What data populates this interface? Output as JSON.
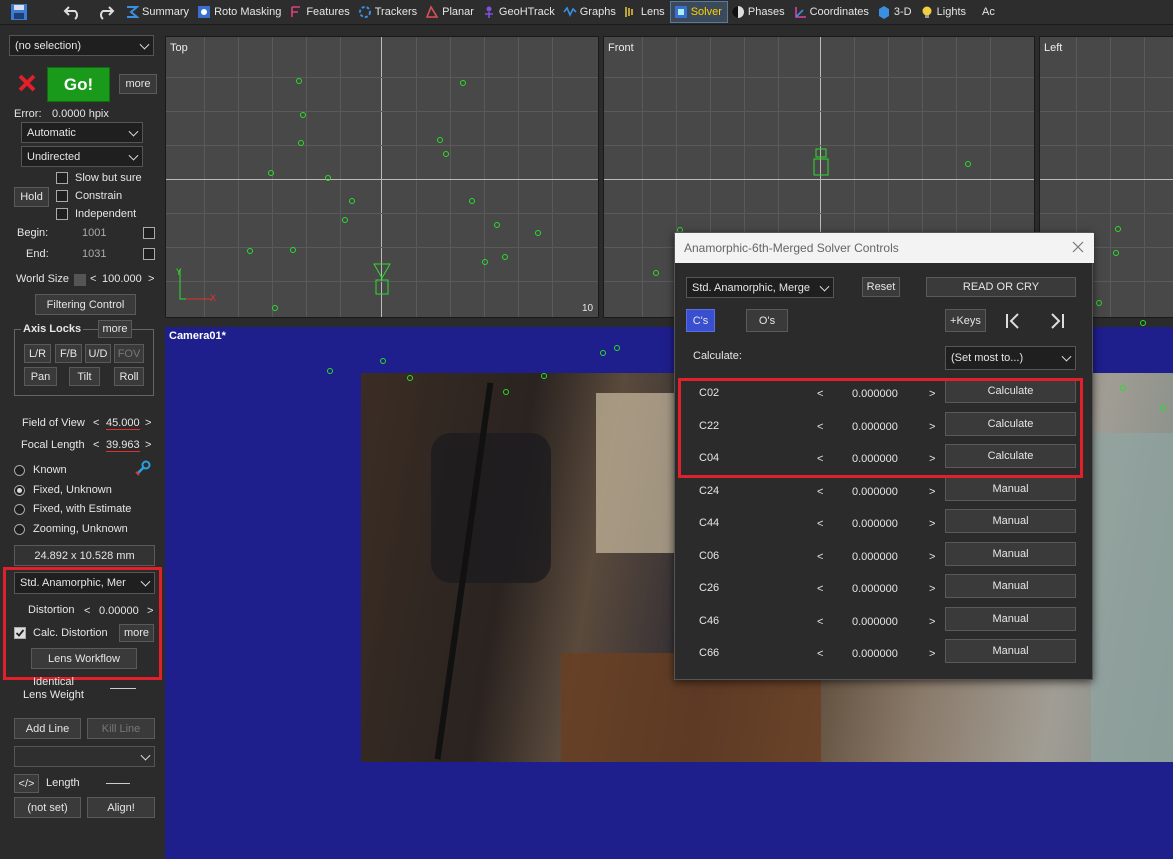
{
  "toolbar": {
    "tabs": [
      {
        "label": "Summary",
        "icon": "summary-icon"
      },
      {
        "label": "Roto Masking",
        "icon": "roto-icon"
      },
      {
        "label": "Features",
        "icon": "features-icon"
      },
      {
        "label": "Trackers",
        "icon": "trackers-icon"
      },
      {
        "label": "Planar",
        "icon": "planar-icon"
      },
      {
        "label": "GeoHTrack",
        "icon": "geohtrack-icon"
      },
      {
        "label": "Graphs",
        "icon": "graphs-icon"
      },
      {
        "label": "Lens",
        "icon": "lens-icon"
      },
      {
        "label": "Solver",
        "icon": "solver-icon",
        "active": true
      },
      {
        "label": "Phases",
        "icon": "phases-icon"
      },
      {
        "label": "Coordinates",
        "icon": "coordinates-icon"
      },
      {
        "label": "3-D",
        "icon": "3d-icon"
      },
      {
        "label": "Lights",
        "icon": "lights-icon"
      }
    ],
    "overflow": "Ac"
  },
  "left": {
    "selection": "(no selection)",
    "go_label": "Go!",
    "more_label": "more",
    "error_label": "Error:",
    "error_value": "0.0000 hpix",
    "mode": "Automatic",
    "direction": "Undirected",
    "slow_but_sure": "Slow but sure",
    "constrain": "Constrain",
    "independent": "Independent",
    "hold_label": "Hold",
    "begin_label": "Begin:",
    "begin_value": "1001",
    "end_label": "End:",
    "end_value": "1031",
    "world_size_label": "World Size",
    "world_size_value": "100.000",
    "filtering_control": "Filtering Control",
    "axis_locks": "Axis Locks",
    "axis_more": "more",
    "axis_buttons": [
      "L/R",
      "F/B",
      "U/D",
      "FOV",
      "Pan",
      "Tilt",
      "Roll"
    ],
    "fov_label": "Field of View",
    "fov_value": "45.000",
    "focal_label": "Focal Length",
    "focal_value": "39.963",
    "lens_modes": [
      "Known",
      "Fixed, Unknown",
      "Fixed, with Estimate",
      "Zooming, Unknown"
    ],
    "sensor_size": "24.892 x 10.528 mm",
    "lens_model": "Std. Anamorphic, Mer",
    "distortion_label": "Distortion",
    "distortion_value": "0.00000",
    "calc_distortion": "Calc. Distortion",
    "calc_more": "more",
    "lens_workflow": "Lens Workflow",
    "identical_lens_weight": "Identical Lens Weight",
    "add_line": "Add Line",
    "kill_line": "Kill Line",
    "length_label": "Length",
    "not_set": "(not set)",
    "align": "Align!",
    "code_icon_label": "</>"
  },
  "viewports": {
    "top": {
      "label": "Top",
      "corner": "10"
    },
    "front": {
      "label": "Front"
    },
    "left": {
      "label": "Left"
    },
    "camera": {
      "label": "Camera01*"
    }
  },
  "dialog": {
    "title": "Anamorphic-6th-Merged Solver Controls",
    "model_select": "Std. Anamorphic, Merge",
    "reset": "Reset",
    "read_or_cry": "READ OR CRY",
    "cs": "C's",
    "os": "O's",
    "plus_keys": "+Keys",
    "calculate_label": "Calculate:",
    "set_most": "(Set most to...)",
    "rows": [
      {
        "name": "C02",
        "value": "0.000000",
        "action": "Calculate"
      },
      {
        "name": "C22",
        "value": "0.000000",
        "action": "Calculate"
      },
      {
        "name": "C04",
        "value": "0.000000",
        "action": "Calculate"
      },
      {
        "name": "C24",
        "value": "0.000000",
        "action": "Manual"
      },
      {
        "name": "C44",
        "value": "0.000000",
        "action": "Manual"
      },
      {
        "name": "C06",
        "value": "0.000000",
        "action": "Manual"
      },
      {
        "name": "C26",
        "value": "0.000000",
        "action": "Manual"
      },
      {
        "name": "C46",
        "value": "0.000000",
        "action": "Manual"
      },
      {
        "name": "C66",
        "value": "0.000000",
        "action": "Manual"
      }
    ]
  },
  "colors": {
    "accent_red": "#e0202a",
    "go_green": "#1a9a1a",
    "camera_bg": "#1e1e8c",
    "tracker_green": "#2bdc2b"
  }
}
